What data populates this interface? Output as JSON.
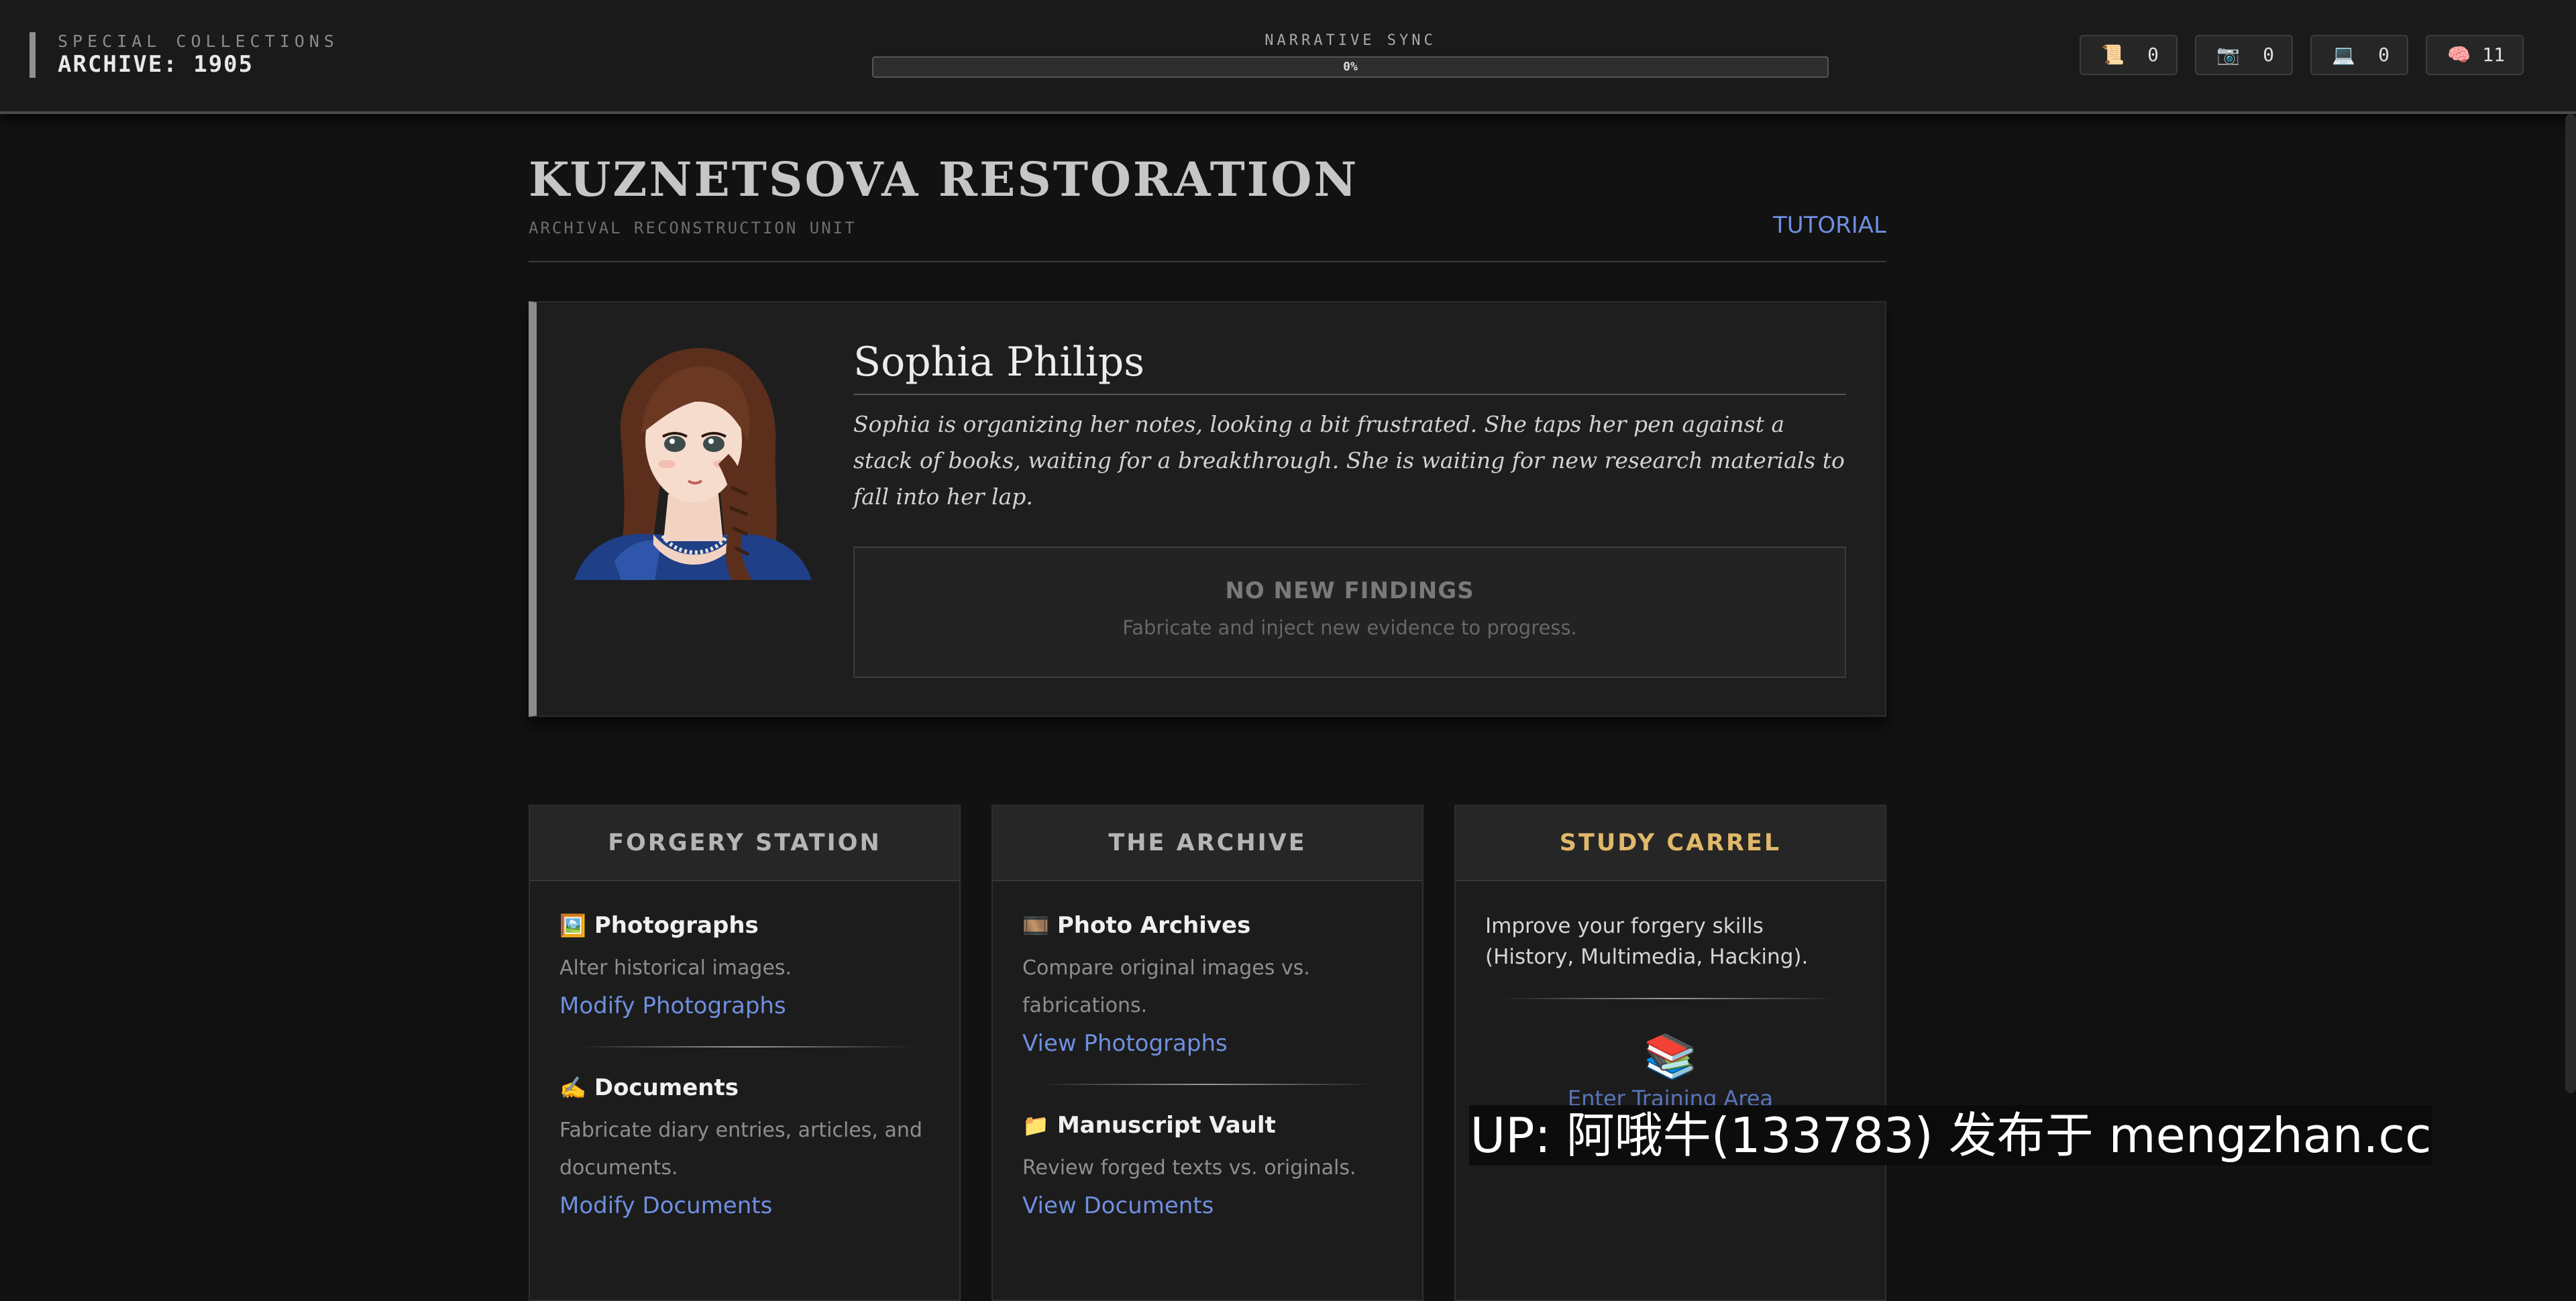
{
  "header": {
    "collection_label": "SPECIAL COLLECTIONS",
    "archive_label": "ARCHIVE: 1905",
    "sync_label": "NARRATIVE SYNC",
    "sync_value": "0%",
    "sync_progress": 0,
    "resources": [
      {
        "icon": "📜",
        "icon_name": "scroll-icon",
        "value": "0"
      },
      {
        "icon": "📷",
        "icon_name": "camera-icon",
        "value": "0"
      },
      {
        "icon": "💻",
        "icon_name": "laptop-icon",
        "value": "0"
      },
      {
        "icon": "🧠",
        "icon_name": "brain-icon",
        "value": "11"
      }
    ]
  },
  "page": {
    "title": "KUZNETSOVA RESTORATION",
    "subtitle": "ARCHIVAL RECONSTRUCTION UNIT",
    "tutorial_label": "TUTORIAL"
  },
  "character": {
    "name": "Sophia Philips",
    "description": "Sophia is organizing her notes, looking a bit frustrated. She taps her pen against a stack of books, waiting for a breakthrough. She is waiting for new research materials to fall into her lap.",
    "findings_title": "NO NEW FINDINGS",
    "findings_hint": "Fabricate and inject new evidence to progress."
  },
  "panels": {
    "forgery": {
      "title": "FORGERY STATION",
      "items": [
        {
          "icon": "🖼️",
          "icon_name": "framed-picture-icon",
          "title": "Photographs",
          "desc": "Alter historical images.",
          "link": "Modify Photographs"
        },
        {
          "icon": "✍️",
          "icon_name": "writing-hand-icon",
          "title": "Documents",
          "desc": "Fabricate diary entries, articles, and documents.",
          "link": "Modify Documents"
        }
      ]
    },
    "archive": {
      "title": "THE ARCHIVE",
      "items": [
        {
          "icon": "🎞️",
          "icon_name": "film-frames-icon",
          "title": "Photo Archives",
          "desc": "Compare original images vs. fabrications.",
          "link": "View Photographs"
        },
        {
          "icon": "📁",
          "icon_name": "folder-icon",
          "title": "Manuscript Vault",
          "desc": "Review forged texts vs. originals.",
          "link": "View Documents"
        }
      ]
    },
    "study": {
      "title": "STUDY CARREL",
      "text": "Improve your forgery skills (History, Multimedia, Hacking).",
      "icon": "📚",
      "icon_name": "books-icon",
      "link": "Enter Training Area"
    }
  },
  "watermark": "UP: 阿哦牛(133783) 发布于 mengzhan.cc",
  "colors": {
    "background": "#121212",
    "link": "#6f8fe0",
    "study_accent": "#e0b86a",
    "panel": "#1c1c1c"
  }
}
